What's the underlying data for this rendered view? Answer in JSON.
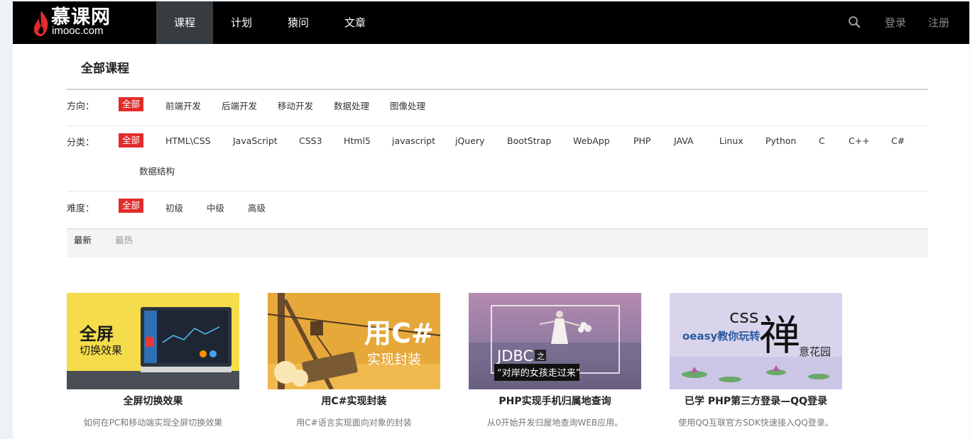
{
  "header": {
    "logo_cn": "慕课网",
    "logo_en": "imooc.com",
    "nav": [
      "课程",
      "计划",
      "猿问",
      "文章"
    ],
    "login": "登录",
    "register": "注册"
  },
  "main": {
    "title": "全部课程",
    "filters": {
      "direction": {
        "label": "方向：",
        "options": [
          "全部",
          "前端开发",
          "后端开发",
          "移动开发",
          "数据处理",
          "图像处理"
        ]
      },
      "category": {
        "label": "分类：",
        "options": [
          "全部",
          "HTML\\CSS",
          "JavaScript",
          "CSS3",
          "Html5",
          "javascript",
          "jQuery",
          "BootStrap",
          "WebApp",
          "PHP",
          "JAVA",
          "Linux",
          "Python",
          "C",
          "C++",
          "C#",
          "数据结构"
        ]
      },
      "level": {
        "label": "难度：",
        "options": [
          "全部",
          "初级",
          "中级",
          "高级"
        ]
      }
    },
    "sort": {
      "newest": "最新",
      "hottest": "最热"
    },
    "courses": [
      {
        "title": "全屏切换效果",
        "desc": "如何在PC和移动端实现全屏切换效果",
        "thumb_text_1": "全屏",
        "thumb_text_2": "切换效果"
      },
      {
        "title": "用C#实现封装",
        "desc": "用C#语言实现面向对象的封装",
        "thumb_text_1": "用C#",
        "thumb_text_2": "实现封装"
      },
      {
        "title": "PHP实现手机归属地查询",
        "desc": "从0开始开发归屋地查询WEB应用。",
        "thumb_text_1": "JDBC",
        "thumb_text_2": "之",
        "thumb_text_3": "“对岸的女孩走过来”"
      },
      {
        "title": "已学 PHP第三方登录—QQ登录",
        "desc": "使用QQ互联官方SDK快速接入QQ登录。",
        "thumb_text_1": "css",
        "thumb_text_2": "禅",
        "thumb_text_3": "oeasy教你玩转",
        "thumb_text_4": "意花园"
      }
    ]
  },
  "colors": {
    "accent": "#e12c2c",
    "header_bg": "#000000",
    "nav_active": "#363c40"
  }
}
